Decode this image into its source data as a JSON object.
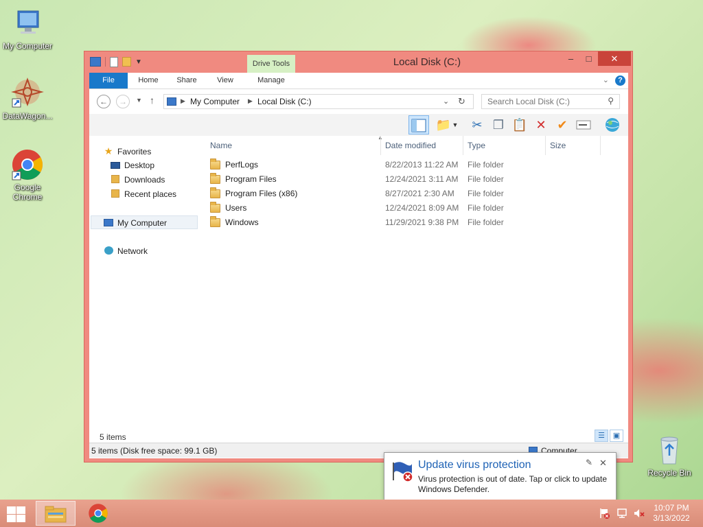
{
  "desktop": {
    "icons": [
      {
        "label": "My Computer"
      },
      {
        "label": "DataWagon..."
      },
      {
        "label": "Google Chrome"
      },
      {
        "label": "Recycle Bin"
      }
    ]
  },
  "window": {
    "title": "Local Disk (C:)",
    "context_tab_group": "Drive Tools",
    "minimize": "–",
    "maximize": "□",
    "close": "✕",
    "tabs": [
      {
        "label": "File"
      },
      {
        "label": "Home"
      },
      {
        "label": "Share"
      },
      {
        "label": "View"
      },
      {
        "label": "Manage"
      }
    ],
    "help": "?"
  },
  "address": {
    "crumbs": [
      "My Computer",
      "Local Disk (C:)"
    ],
    "search_placeholder": "Search Local Disk (C:)"
  },
  "nav_pane": {
    "favorites": "Favorites",
    "items": [
      "Desktop",
      "Downloads",
      "Recent places"
    ],
    "my_computer": "My Computer",
    "network": "Network"
  },
  "columns": {
    "name": "Name",
    "date": "Date modified",
    "type": "Type",
    "size": "Size"
  },
  "files": [
    {
      "name": "PerfLogs",
      "date": "8/22/2013 11:22 AM",
      "type": "File folder"
    },
    {
      "name": "Program Files",
      "date": "12/24/2021 3:11 AM",
      "type": "File folder"
    },
    {
      "name": "Program Files (x86)",
      "date": "8/27/2021 2:30 AM",
      "type": "File folder"
    },
    {
      "name": "Users",
      "date": "12/24/2021 8:09 AM",
      "type": "File folder"
    },
    {
      "name": "Windows",
      "date": "11/29/2021 9:38 PM",
      "type": "File folder"
    }
  ],
  "status": {
    "item_count": "5 items",
    "bar_text": "5 items (Disk free space: 99.1 GB)",
    "location": "Computer"
  },
  "toast": {
    "title": "Update virus protection",
    "body": "Virus protection is out of date. Tap or click to update Windows Defender."
  },
  "taskbar": {
    "time": "10:07 PM",
    "date": "3/13/2022"
  },
  "colors": {
    "accent": "#1979ca",
    "window_frame": "#f08a80",
    "taskbar": "#d98c78"
  }
}
